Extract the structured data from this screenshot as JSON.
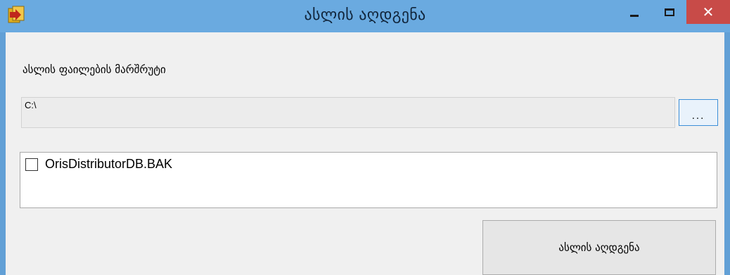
{
  "window": {
    "title": "ასლის აღდგენა",
    "app_icon": "database-restore-icon",
    "minimize_icon": "minimize-icon",
    "maximize_icon": "maximize-icon",
    "close_icon": "close-icon",
    "close_glyph": "✕"
  },
  "form": {
    "path_label": "ასლის ფაილების მარშრუტი",
    "path_value": "C:\\",
    "browse_label": "...",
    "files": [
      {
        "name": "OrisDistributorDB.BAK",
        "checked": false
      }
    ],
    "restore_button_label": "ასლის აღდგენა"
  },
  "colors": {
    "titlebar": "#6aaae0",
    "close_button": "#c84b48",
    "client_background": "#f0f0f0",
    "browse_border": "#3c8fd8"
  }
}
